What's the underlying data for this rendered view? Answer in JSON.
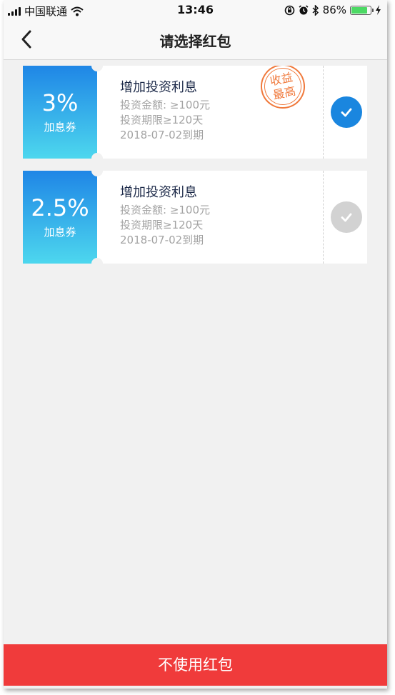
{
  "status_bar": {
    "carrier": "中国联通",
    "time": "13:46",
    "battery": "86%",
    "battery_level": 0.86,
    "icons": [
      "signal-icon",
      "wifi-icon",
      "screen-lock-icon",
      "alarm-icon",
      "bluetooth-icon",
      "battery-icon",
      "charging-icon"
    ]
  },
  "nav": {
    "title": "请选择红包",
    "back_icon": "back-chevron-icon"
  },
  "coupons": [
    {
      "rate": "3%",
      "type": "加息券",
      "title": "增加投资利息",
      "amount": "投资金额: ≥100元",
      "period": "投资期限≥120天",
      "expiry": "2018-07-02到期",
      "stamp": [
        "收益",
        "最高"
      ],
      "selected": true
    },
    {
      "rate": "2.5%",
      "type": "加息券",
      "title": "增加投资利息",
      "amount": "投资金额: ≥100元",
      "period": "投资期限≥120天",
      "expiry": "2018-07-02到期",
      "selected": false
    }
  ],
  "bottom_button": {
    "label": "不使用红包"
  },
  "colors": {
    "selected_check": "#1a86df",
    "unselected_check": "#d2d2d2",
    "stamp": "#f07a3d",
    "bottom_button": "#f03b3b",
    "stub_gradient_top": "#1f86e6",
    "stub_gradient_bottom": "#4dd7ee"
  }
}
